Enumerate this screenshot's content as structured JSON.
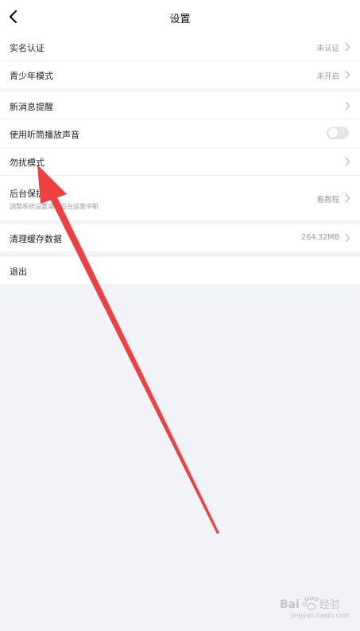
{
  "header": {
    "title": "设置"
  },
  "groups": [
    {
      "items": [
        {
          "label": "实名认证",
          "value": "未认证",
          "chevron": true
        },
        {
          "label": "青少年模式",
          "value": "未开启",
          "chevron": true
        }
      ]
    },
    {
      "items": [
        {
          "label": "新消息提醒",
          "chevron": true
        },
        {
          "label": "使用听筒播放声音",
          "toggle": false
        },
        {
          "label": "勿扰模式",
          "chevron": true
        },
        {
          "label": "后台保护",
          "subtitle": "调整系统设置减少后台运营中断",
          "value": "看教程",
          "chevron": true
        }
      ]
    },
    {
      "items": [
        {
          "label": "清理缓存数据",
          "value": "264.32MB",
          "chevron": true
        }
      ]
    },
    {
      "items": [
        {
          "label": "退出"
        }
      ]
    }
  ],
  "watermark": {
    "brand": "Baidu经验",
    "url": "jingyan.baidu.com"
  },
  "colors": {
    "background": "#f2f3f8",
    "annotation_arrow": "#ee4040",
    "secondary_text": "#9a9a9a"
  }
}
